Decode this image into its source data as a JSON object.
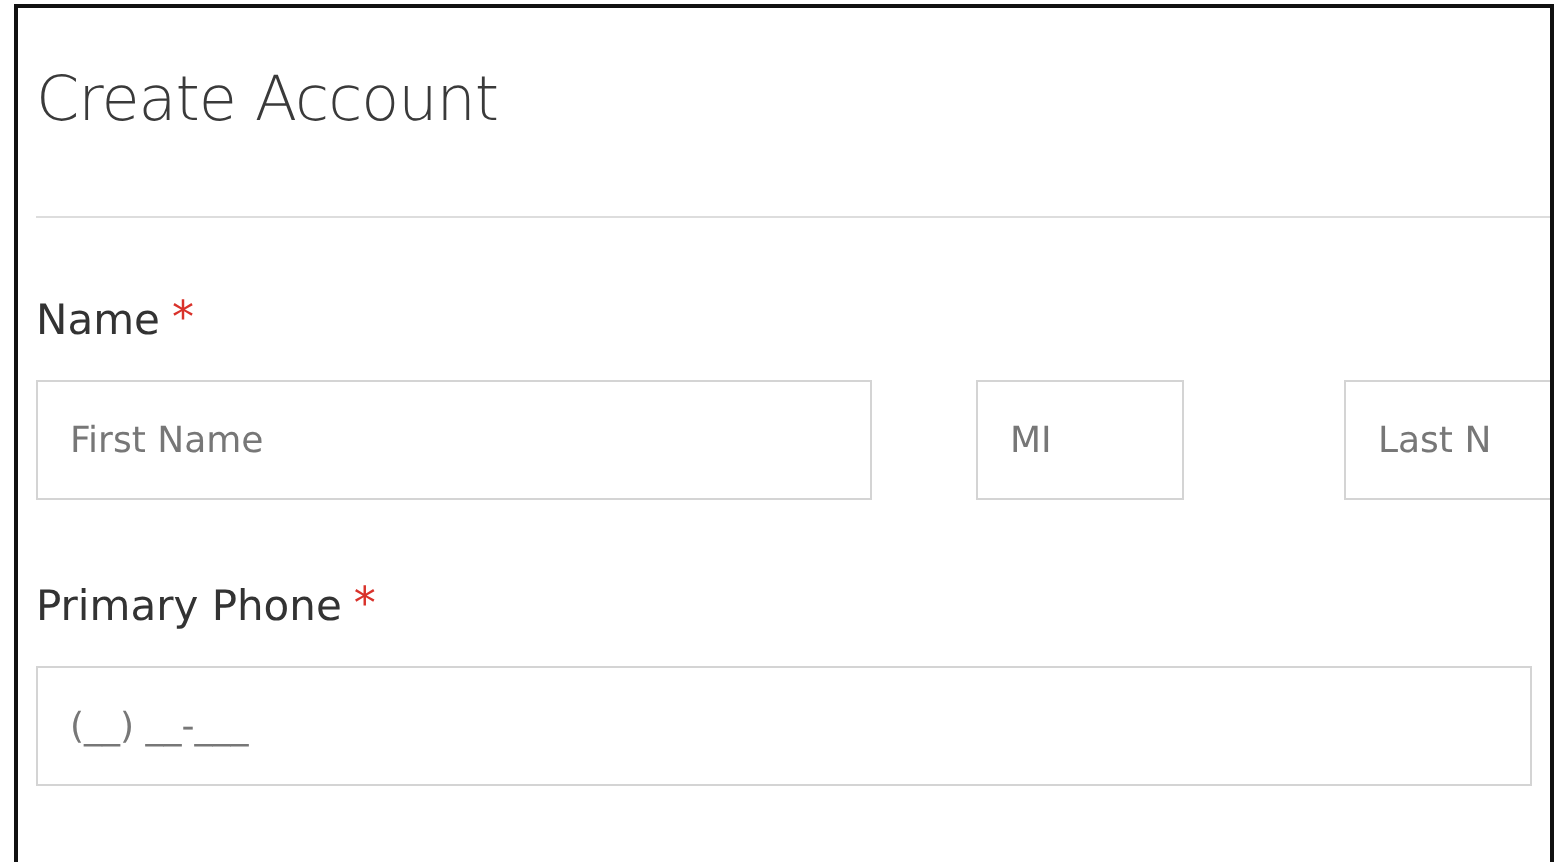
{
  "title": "Create Account",
  "fields": [
    {
      "label": "Name",
      "required_mark": "*",
      "inputs": [
        {
          "placeholder": "First Name"
        },
        {
          "placeholder": "MI"
        },
        {
          "placeholder": "Last N"
        }
      ]
    },
    {
      "label": "Primary Phone",
      "required_mark": "*",
      "inputs": [
        {
          "placeholder": "(__) __-___"
        }
      ]
    }
  ]
}
